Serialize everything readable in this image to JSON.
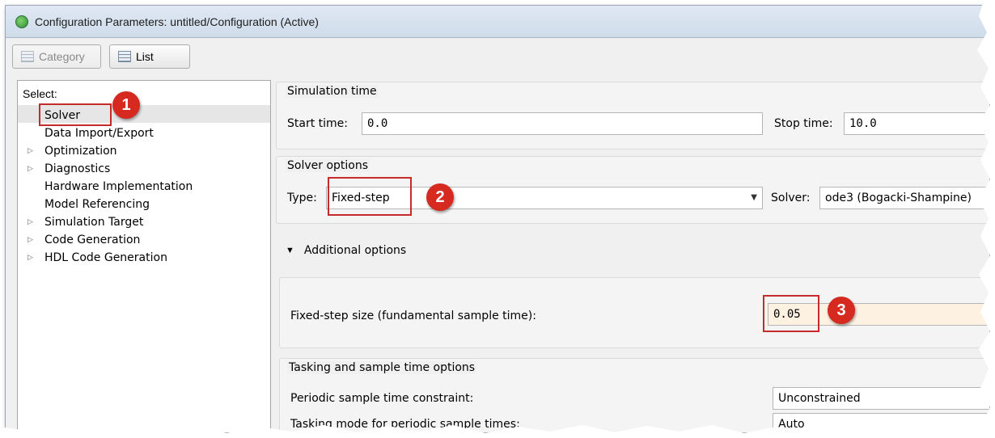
{
  "window": {
    "title": "Configuration Parameters: untitled/Configuration (Active)"
  },
  "toolbar": {
    "category_label": "Category",
    "list_label": "List"
  },
  "tree": {
    "select_label": "Select:",
    "items": [
      {
        "label": "Solver",
        "expandable": false,
        "selected": true
      },
      {
        "label": "Data Import/Export",
        "expandable": false
      },
      {
        "label": "Optimization",
        "expandable": true
      },
      {
        "label": "Diagnostics",
        "expandable": true
      },
      {
        "label": "Hardware Implementation",
        "expandable": false
      },
      {
        "label": "Model Referencing",
        "expandable": false
      },
      {
        "label": "Simulation Target",
        "expandable": true
      },
      {
        "label": "Code Generation",
        "expandable": true
      },
      {
        "label": "HDL Code Generation",
        "expandable": true
      }
    ]
  },
  "simulation_time": {
    "title": "Simulation time",
    "start_label": "Start time:",
    "start_value": "0.0",
    "stop_label": "Stop time:",
    "stop_value": "10.0"
  },
  "solver_options": {
    "title": "Solver options",
    "type_label": "Type:",
    "type_value": "Fixed-step",
    "solver_label": "Solver:",
    "solver_value": "ode3 (Bogacki-Shampine)"
  },
  "additional_options": {
    "toggle_label": "Additional options",
    "fixed_step_label": "Fixed-step size (fundamental sample time):",
    "fixed_step_value": "0.05"
  },
  "tasking": {
    "title": "Tasking and sample time options",
    "periodic_label": "Periodic sample time constraint:",
    "periodic_value": "Unconstrained",
    "tasking_mode_label": "Tasking mode for periodic sample times:",
    "tasking_mode_value": "Auto"
  },
  "callouts": {
    "one": "1",
    "two": "2",
    "three": "3"
  },
  "colors": {
    "callout_red": "#d6291f",
    "fixed_step_highlight": "#fdf2e2"
  }
}
